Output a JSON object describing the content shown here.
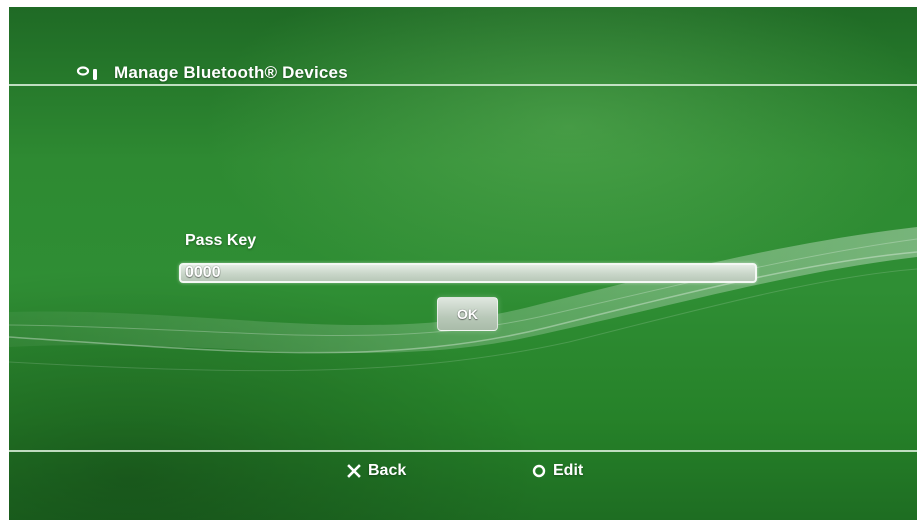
{
  "header": {
    "title": "Manage Bluetooth® Devices",
    "icon": "bluetooth-device-icon"
  },
  "form": {
    "pass_key_label": "Pass Key",
    "pass_key_value": "0000"
  },
  "actions": {
    "ok_label": "OK"
  },
  "footer": {
    "back": {
      "icon": "cross-button-icon",
      "label": "Back"
    },
    "edit": {
      "icon": "circle-button-icon",
      "label": "Edit"
    }
  },
  "colors": {
    "background": "#2e8a32",
    "text": "#ffffff",
    "rule": "#dcf0dc"
  }
}
